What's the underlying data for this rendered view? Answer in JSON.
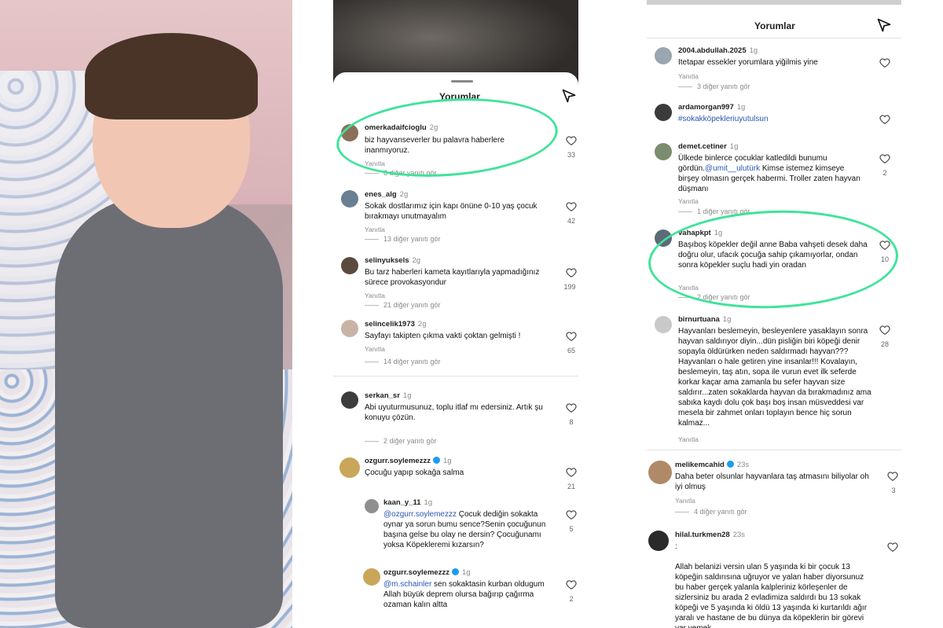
{
  "left_phone": {
    "header": {
      "title": "Yorumlar"
    },
    "comments": [
      {
        "user": "omerkadaifcioglu",
        "time": "2g",
        "text": "biz hayvanseverler bu palavra haberlere inanmıyoruz.",
        "reply": "Yanıtla",
        "more": "8 diğer yanıtı gör",
        "likes": "33"
      },
      {
        "user": "enes_alg",
        "time": "2g",
        "text": "Sokak dostlarımız için kapı önüne 0-10 yaş çocuk bırakmayı unutmayalım",
        "reply": "Yanıtla",
        "more": "13 diğer yanıtı gör",
        "likes": "42"
      },
      {
        "user": "selinyuksels",
        "time": "2g",
        "text": "Bu tarz haberleri kameta kayıtlarıyla yapmadığınız sürece provokasyondur",
        "reply": "Yanıtla",
        "more": "21 diğer yanıtı gör",
        "likes": "199"
      },
      {
        "user": "selincelik1973",
        "time": "2g",
        "text": "Sayfayı takipten çıkma vakti çoktan gelmişti !",
        "reply": "Yanıtla",
        "more": "14 diğer yanıtı gör",
        "likes": "65"
      },
      {
        "user": "serkan_sr",
        "time": "1g",
        "text": "Abi uyuturmusunuz, toplu itlaf mı edersiniz. Artık şu konuyu çözün.",
        "more": "2 diğer yanıtı gör",
        "likes": "8"
      },
      {
        "user": "ozgurr.soylemezzz",
        "time": "1g",
        "text": "Çocuğu yapıp sokağa salma",
        "likes": "21"
      },
      {
        "user": "kaan_y_11",
        "time": "1g",
        "mention": "@ozgurr.soylemezzz",
        "text": " Çocuk dediğin sokakta oynar ya sorun bumu sence?Senin çocuğunun başına gelse bu olay ne dersin? Çocuğunamı yoksa Köpekleremi kızarsın?",
        "likes": "5"
      },
      {
        "user": "ozgurr.soylemezzz",
        "time": "1g",
        "mention": "@m.schainler",
        "text": " sen sokaktasin kurban oldugum Allah büyük deprem olursa bağırıp çağırma ozaman kalın altta",
        "likes": "2"
      }
    ]
  },
  "right_phone": {
    "header": {
      "title": "Yorumlar"
    },
    "comments": [
      {
        "user": "2004.abdullah.2025",
        "time": "1g",
        "text": "Itetapar essekler yorumlara yiğilmis yine",
        "reply": "Yanıtla",
        "more": "3 diğer yanıtı gör"
      },
      {
        "user": "ardamorgan997",
        "time": "1g",
        "text": "#sokakköpekleriuyutulsun"
      },
      {
        "user": "demet.cetiner",
        "time": "1g",
        "text_a": "Ülkede binlerce çocuklar katledildi bunumu gördün.",
        "mention": "@umit__ulutürk",
        "text_b": " Kimse istemez kimseye birşey olmasın gerçek habermi. Troller zaten hayvan düşmanı",
        "reply": "Yanıtla",
        "more": "1 diğer yanıtı gör",
        "likes": "2"
      },
      {
        "user": "vahapkpt",
        "time": "1g",
        "text": "Başıboş köpekler değil anne Baba vahşeti desek daha doğru olur, ufacık çocuğa sahip çıkamıyorlar, ondan sonra köpekler suçlu hadi yin oradan",
        "reply": "Yanıtla",
        "more": "2 diğer yanıtı gör",
        "likes": "10"
      },
      {
        "user": "birnurtuana",
        "time": "1g",
        "text": "Hayvanları beslemeyin, besleyenlere yasaklayın sonra hayvan saldırıyor diyin...dün pisliğin biri köpeği denir sopayla öldürürken neden saldırmadı hayvan??? Hayvanları o hale getiren yine insanlar!!! Kovalayın, beslemeyin, taş atın, sopa ile vurun evet ilk seferde korkar kaçar ama zamanla bu sefer hayvan size saldırır...zaten sokaklarda hayvan da bırakmadınız ama sabıka kaydı dolu çok başı boş insan müsveddesi var mesela bir zahmet onları toplayın bence hiç sorun kalmaz...",
        "reply": "Yanıtla",
        "likes": "28"
      },
      {
        "user": "melikemcahid",
        "time": "23s",
        "text": "Daha beter olsunlar hayvanlara taş atmasını biliyolar oh iyi olmuş",
        "reply": "Yanıtla",
        "more": "4 diğer yanıtı gör",
        "likes": "3"
      },
      {
        "user": "hilal.turkmen28",
        "time": "23s",
        "text": ":\n\nAllah belanizi versin ulan 5 yaşında ki bir çocuk 13 köpeğin saldırısına uğruyor ve yalan haber diyorsunuz bu haber gerçek yalanla kalpleriniz körleşenler de sizlersiniz bu arada 2 evladimiza saldırdı bu 13 sokak köpeği ve 5 yaşında ki öldü 13 yaşında ki kurtarıldı ağır yaralı ve hastane de bu dünya da köpeklerin bir görevi var yemek"
      }
    ]
  },
  "colors": {
    "highlight": "#3fe39a",
    "mention": "#2b56b5",
    "verified": "#1d9bf0"
  }
}
